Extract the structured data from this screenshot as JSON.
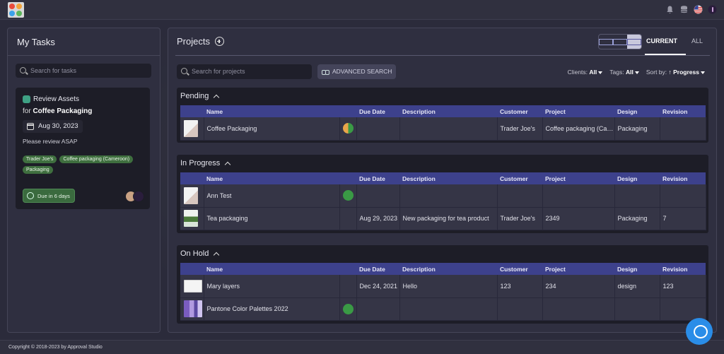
{
  "top_bar": {
    "icons": [
      "app-logo",
      "bell-icon",
      "database-icon",
      "us-flag-icon",
      "user-avatar"
    ]
  },
  "tasks": {
    "title": "My Tasks",
    "search_placeholder": "Search for tasks",
    "card": {
      "action": "Review Assets",
      "for_prefix": "for",
      "project": "Coffee Packaging",
      "date": "Aug 30, 2023",
      "note": "Please review ASAP",
      "tags": [
        "Trader Joe's",
        "Coffee packaging (Cameroon)",
        "Packaging"
      ],
      "due": "Due in 6 days"
    }
  },
  "projects": {
    "title": "Projects",
    "tabs": {
      "current": "CURRENT",
      "all": "ALL"
    },
    "search_placeholder": "Search for projects",
    "advanced_search": "ADVANCED SEARCH",
    "filters": {
      "clients_label": "Clients:",
      "clients_value": "All",
      "tags_label": "Tags:",
      "tags_value": "All",
      "sort_label": "Sort by:",
      "sort_arrow": "↑",
      "sort_value": "Progress"
    },
    "columns": [
      "Name",
      "Due Date",
      "Description",
      "Customer",
      "Project",
      "Design",
      "Revision"
    ],
    "groups": [
      {
        "title": "Pending",
        "rows": [
          {
            "name": "Coffee Packaging",
            "due": "",
            "description": "",
            "customer": "Trader Joe's",
            "project": "Coffee packaging (Cameroon)",
            "design": "Packaging",
            "revision": "",
            "status": "partial"
          }
        ]
      },
      {
        "title": "In Progress",
        "rows": [
          {
            "name": "Ann Test",
            "due": "",
            "description": "",
            "customer": "",
            "project": "",
            "design": "",
            "revision": "",
            "status": "green"
          },
          {
            "name": "Tea packaging",
            "due": "Aug 29, 2023",
            "description": "New packaging for tea product",
            "customer": "Trader Joe's",
            "project": "2349",
            "design": "Packaging",
            "revision": "7",
            "status": ""
          }
        ]
      },
      {
        "title": "On Hold",
        "rows": [
          {
            "name": "Mary layers",
            "due": "Dec 24, 2021",
            "description": "Hello",
            "customer": "123",
            "project": "234",
            "design": "design",
            "revision": "123",
            "status": ""
          },
          {
            "name": "Pantone Color Palettes 2022",
            "due": "",
            "description": "",
            "customer": "",
            "project": "",
            "design": "",
            "revision": "",
            "status": "green"
          }
        ]
      }
    ]
  },
  "footer": {
    "copyright": "Copyright © 2018-2023 by Approval Studio"
  },
  "colors": {
    "accent": "#3d418c",
    "status_green": "#3a9a45",
    "tag_green": "#3f6f3f",
    "chat_blue": "#2a8de8"
  }
}
